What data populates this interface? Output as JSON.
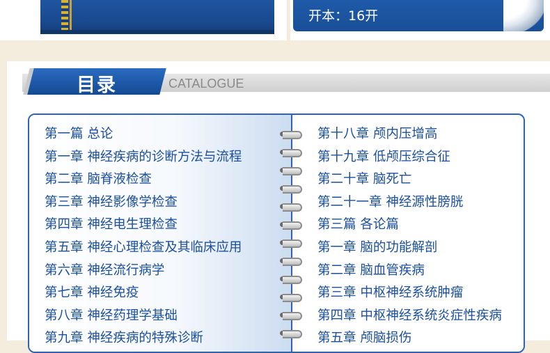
{
  "top": {
    "spec_text": "开本：16开"
  },
  "catalog": {
    "title": "目录",
    "subtitle": "CATALOGUE"
  },
  "left_items": [
    "第一篇 总论",
    "第一章 神经疾病的诊断方法与流程",
    "第二章 脑脊液检查",
    "第三章 神经影像学检查",
    "第四章 神经电生理检查",
    "第五章 神经心理检查及其临床应用",
    "第六章 神经流行病学",
    "第七章 神经免疫",
    "第八章 神经药理学基础",
    "第九章 神经疾病的特殊诊断"
  ],
  "right_items": [
    "第十八章 颅内压增高",
    "第十九章 低颅压综合征",
    "第二十章 脑死亡",
    "第二十一章 神经源性膀胱",
    "第三篇 各论篇",
    "第一章 脑的功能解剖",
    "第二章 脑血管疾病",
    "第三章 中枢神经系统肿瘤",
    "第四章 中枢神经系统炎症性疾病",
    "第五章 颅脑损伤"
  ],
  "colors": {
    "accent_blue": "#1e5aa8",
    "text_blue": "#1a4f9e",
    "background": "#f4ecdc"
  }
}
